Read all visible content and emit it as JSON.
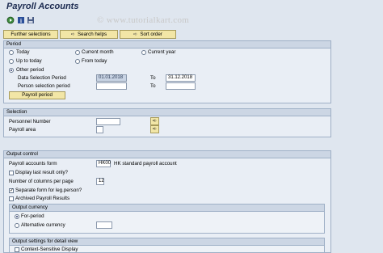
{
  "window": {
    "title": "Payroll Accounts",
    "watermark": "© www.tutorialkart.com"
  },
  "toolbar": {
    "icons": [
      "execute-icon",
      "info-icon",
      "save-variant-icon"
    ],
    "further_selections": "Further selections",
    "search_helps": "Search helps",
    "sort_order": "Sort order"
  },
  "period": {
    "header": "Period",
    "today": "Today",
    "current_month": "Current month",
    "current_year": "Current year",
    "up_to_today": "Up to today",
    "from_today": "From today",
    "other_period": "Other period",
    "data_selection_period": "Data Selection Period",
    "from_date": "01.01.2018",
    "to_label": "To",
    "to_date": "31.12.2018",
    "person_selection_period": "Person selection period",
    "person_to_label": "To",
    "payroll_period_button": "Payroll period",
    "selected": "Other period"
  },
  "selection": {
    "header": "Selection",
    "personnel_number": "Personnel Number",
    "payroll_area": "Payroll area"
  },
  "output_control": {
    "header": "Output control",
    "payroll_accounts_form_label": "Payroll accounts form",
    "payroll_accounts_form_value": "HK00",
    "payroll_accounts_form_desc": "HK standard payroll account",
    "display_last_result": "Display last result only?",
    "num_columns_label": "Number of columns per page",
    "num_columns_value": "12",
    "separate_form": "Separate form for leg.person?",
    "archived_results": "Archived Payroll Results"
  },
  "output_currency": {
    "header": "Output currency",
    "for_period": "For-period",
    "alternative_currency": "Alternative currency",
    "selected": "For-period"
  },
  "detail_view": {
    "header": "Output settings for detail view",
    "context_sensitive": "Context-Sensitive Display"
  }
}
